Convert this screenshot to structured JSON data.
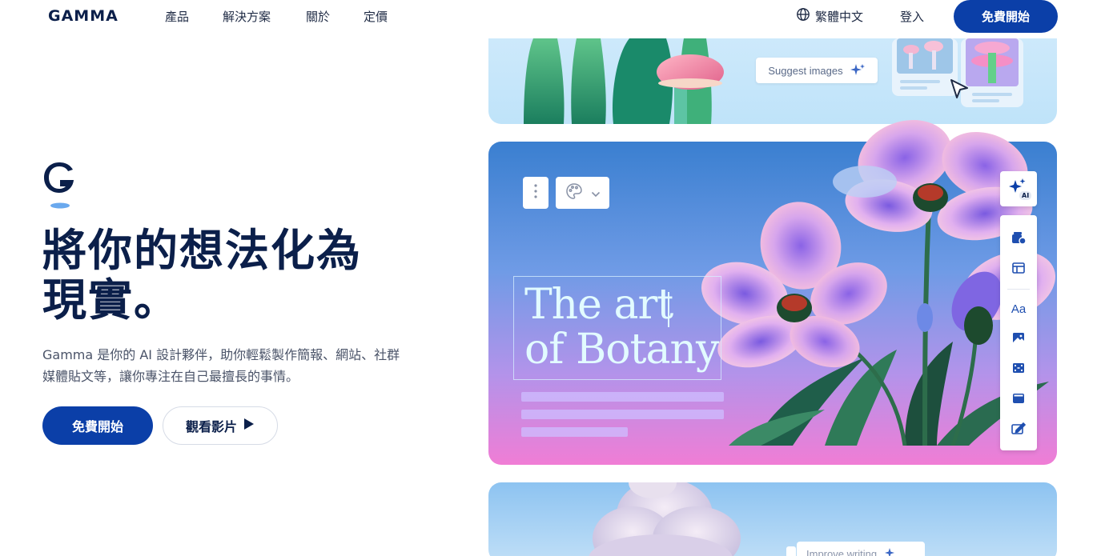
{
  "nav": {
    "logo": "GAMMA",
    "links": [
      "產品",
      "解決方案",
      "關於",
      "定價"
    ],
    "language": "繁體中文",
    "login": "登入",
    "cta": "免費開始"
  },
  "hero": {
    "headline_line1": "將你的想法化為",
    "headline_line2": "現實。",
    "subtext_line1": "Gamma 是你的 AI 設計夥伴，助你輕鬆製作簡報、網站、社群",
    "subtext_line2": "媒體貼文等，讓你專注在自己最擅長的事情。",
    "primary_button": "免費開始",
    "secondary_button": "觀看影片"
  },
  "showcase": {
    "suggest_chip": "Suggest images",
    "slide_title_line1": "The art",
    "slide_title_line2": "of Botany",
    "ai_badge": "AI",
    "tool_icons": [
      "add-card-icon",
      "layout-icon",
      "text-icon",
      "image-icon",
      "video-icon",
      "embed-icon",
      "edit-icon"
    ],
    "improve_chip": "Improve writing"
  },
  "colors": {
    "brand": "#0b3fa8",
    "heading": "#0b1f4a"
  }
}
